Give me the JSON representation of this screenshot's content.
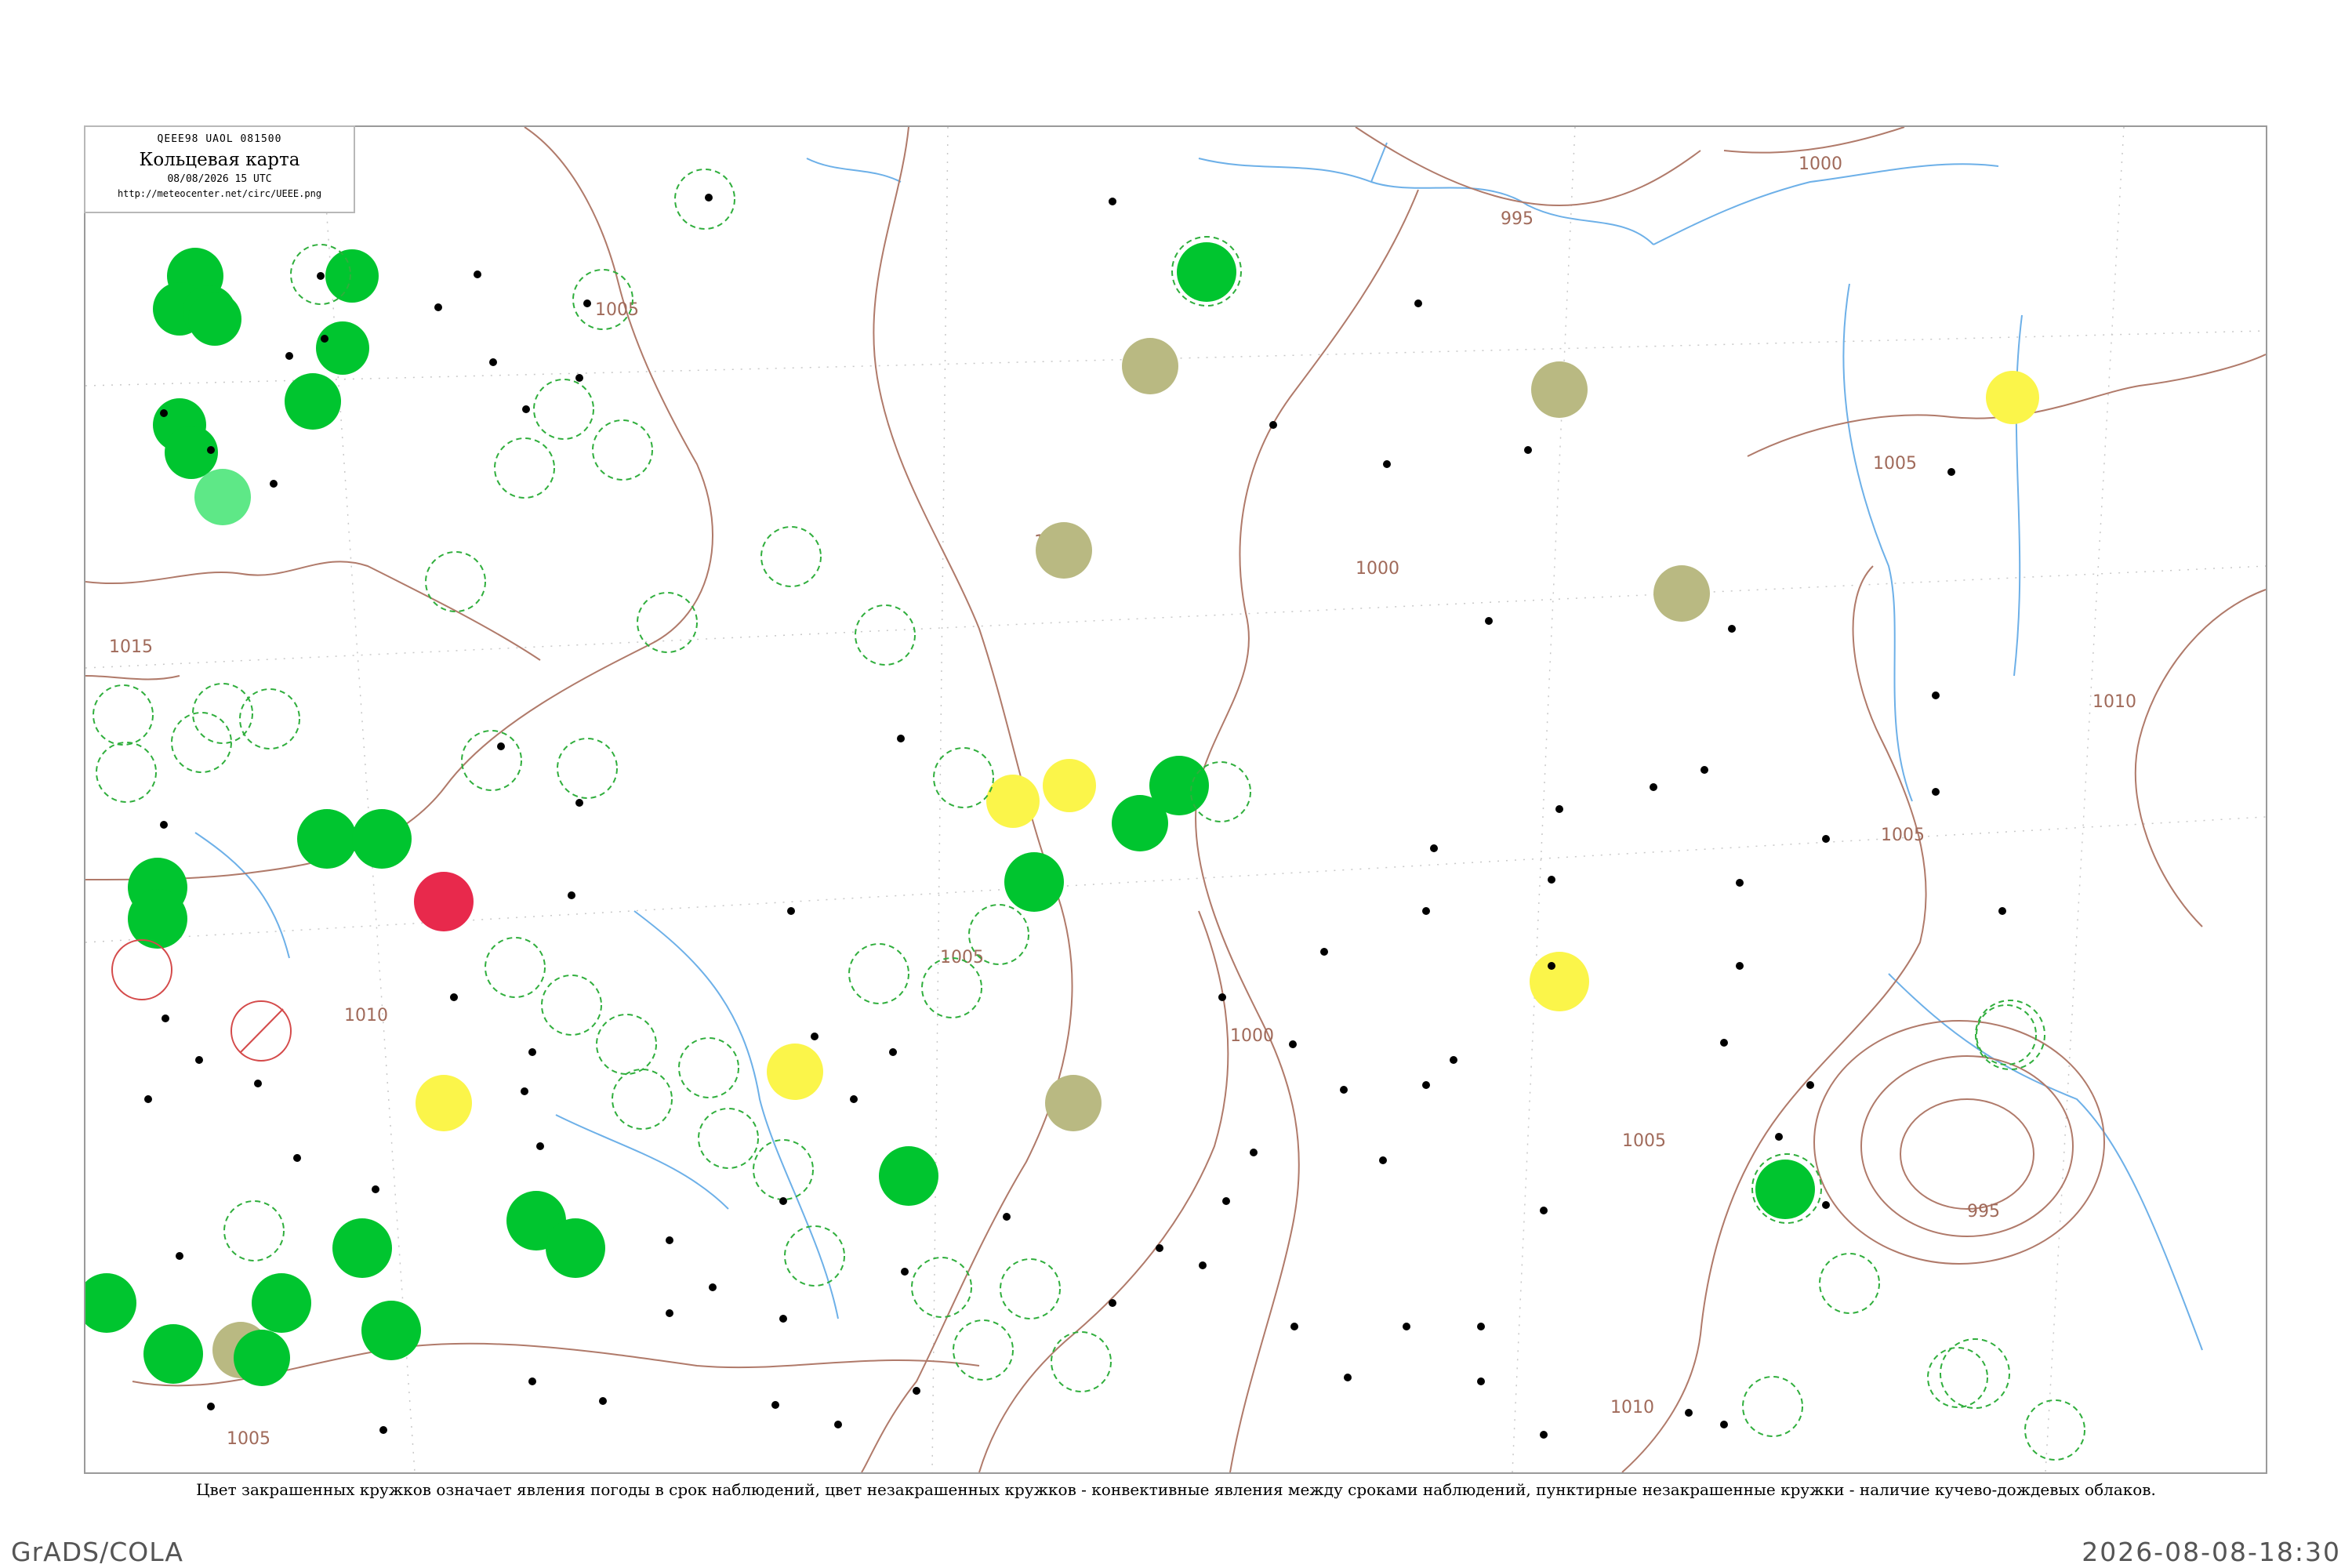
{
  "header": {
    "codes": "QEEE98  UAOL  081500",
    "title": "Кольцевая карта",
    "date": "08/08/2026 15 UTC",
    "url": "http://meteocenter.net/circ/UEEE.png"
  },
  "isobars": {
    "labels": [
      "995",
      "1000",
      "1005",
      "1010",
      "1015"
    ]
  },
  "colors": {
    "isobar": "#b07a6a",
    "river": "#6db0e8",
    "frame": "#9a9a9a",
    "green_circle": "#00c52f",
    "olive_circle": "#b9b982",
    "yellow_circle": "#fbf54a",
    "red_circle": "#e8294c",
    "dashed_ring": "#2fae3c",
    "red_ring": "#d44a4a"
  },
  "caption": "Цвет закрашенных кружков означает явления погоды в срок наблюдений, цвет незакрашенных кружков - конвективные явления между сроками наблюдений, пунктирные незакрашенные кружки - наличие кучево-дождевых облаков.",
  "footer": {
    "left": "GrADS/COLA",
    "right": "2026-08-08-18:30"
  }
}
